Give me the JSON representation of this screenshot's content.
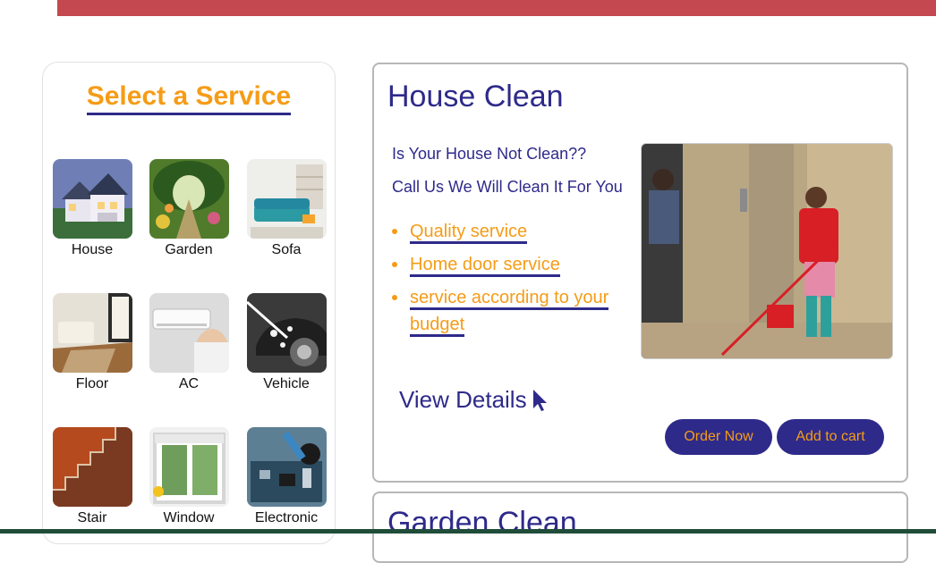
{
  "sidebar": {
    "title": "Select a Service",
    "services": [
      {
        "label": "House",
        "icon": "house-photo"
      },
      {
        "label": "Garden",
        "icon": "garden-photo"
      },
      {
        "label": "Sofa",
        "icon": "sofa-photo"
      },
      {
        "label": "Floor",
        "icon": "floor-photo"
      },
      {
        "label": "AC",
        "icon": "ac-photo"
      },
      {
        "label": "Vehicle",
        "icon": "vehicle-photo"
      },
      {
        "label": "Stair",
        "icon": "stair-photo"
      },
      {
        "label": "Window",
        "icon": "window-photo"
      },
      {
        "label": "Electronic",
        "icon": "electronic-photo"
      }
    ]
  },
  "cards": [
    {
      "title": "House Clean",
      "line1": "Is Your House Not Clean??",
      "line2": "Call Us We Will Clean It For You",
      "features": [
        "Quality service",
        "Home door service",
        "service according to your budget"
      ],
      "view_details": "View Details",
      "order_button": "Order Now",
      "cart_button": "Add to cart"
    },
    {
      "title": "Garden Clean"
    }
  ],
  "colors": {
    "accent_orange": "#f59c17",
    "primary_navy": "#2e2a8a",
    "top_bar": "#c4484f",
    "bottom_bar": "#1f4d3a"
  }
}
